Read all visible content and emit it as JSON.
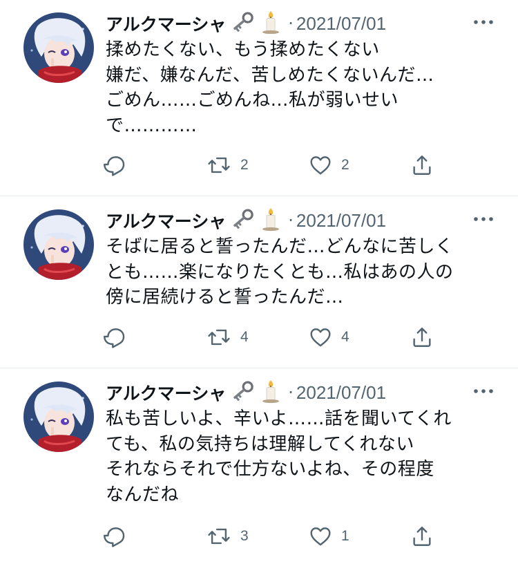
{
  "feed": {
    "tweets": [
      {
        "name": "アルクマーシャ",
        "separator": "·",
        "date": "2021/07/01",
        "lines": [
          "揉めたくない、もう揉めたくない",
          "嫌だ、嫌なんだ、苦しめたくないんだ…",
          "ごめん……ごめんね…私が弱いせい",
          "で…………"
        ],
        "retweets": "2",
        "likes": "2"
      },
      {
        "name": "アルクマーシャ",
        "separator": "·",
        "date": "2021/07/01",
        "lines": [
          "そばに居ると誓ったんだ…どんなに苦しく",
          "とも……楽になりたくとも…私はあの人の",
          "傍に居続けると誓ったんだ…"
        ],
        "retweets": "4",
        "likes": "4"
      },
      {
        "name": "アルクマーシャ",
        "separator": "·",
        "date": "2021/07/01",
        "lines": [
          "私も苦しいよ、辛いよ……話を聞いてくれ",
          "ても、私の気持ちは理解してくれない",
          "それならそれで仕方ないよね、その程度",
          "なんだね"
        ],
        "retweets": "3",
        "likes": "1"
      }
    ]
  },
  "icons": {
    "reply": "reply-icon",
    "retweet": "retweet-icon",
    "like": "heart-icon",
    "share": "share-icon",
    "more": "more-icon",
    "name_emoji_1": "key-icon",
    "name_emoji_2": "candle-icon"
  },
  "colors": {
    "text": "#0f1419",
    "secondary": "#536471",
    "divider": "#e6ecf0",
    "avatar_bg": "#2f4a7a"
  }
}
